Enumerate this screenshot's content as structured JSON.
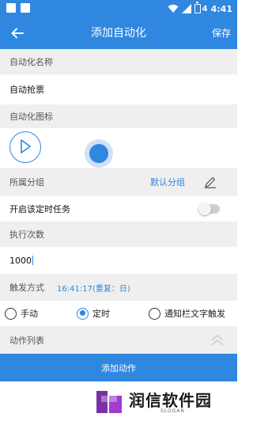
{
  "status_bar": {
    "time": "4:41",
    "battery": "4"
  },
  "header": {
    "title": "添加自动化",
    "save_label": "保存"
  },
  "form": {
    "name_label": "自动化名称",
    "name_value": "自动抢票",
    "icon_label": "自动化图标",
    "group_label": "所属分组",
    "group_value": "默认分组",
    "schedule_label": "开启该定时任务",
    "schedule_enabled": false,
    "exec_count_label": "执行次数",
    "exec_count_value": "1000",
    "trigger_label": "触发方式",
    "trigger_time": "16:41:17(重复：日)",
    "trigger_options": [
      {
        "label": "手动",
        "checked": false
      },
      {
        "label": "定时",
        "checked": true
      },
      {
        "label": "通知栏文字触发",
        "checked": false
      }
    ],
    "action_list_label": "动作列表"
  },
  "footer": {
    "add_action_label": "添加动作"
  },
  "watermark": {
    "text": "润信软件园",
    "slogan": "SLOGAN"
  },
  "icons": [
    "back-arrow-icon",
    "play-icon",
    "edit-pen-icon",
    "chevron-up-icon",
    "wifi-icon",
    "signal-icon",
    "battery-icon"
  ],
  "colors": {
    "primary": "#2f87e0",
    "row_gray": "#efefef",
    "brand_purple": "#7b2fa8"
  }
}
